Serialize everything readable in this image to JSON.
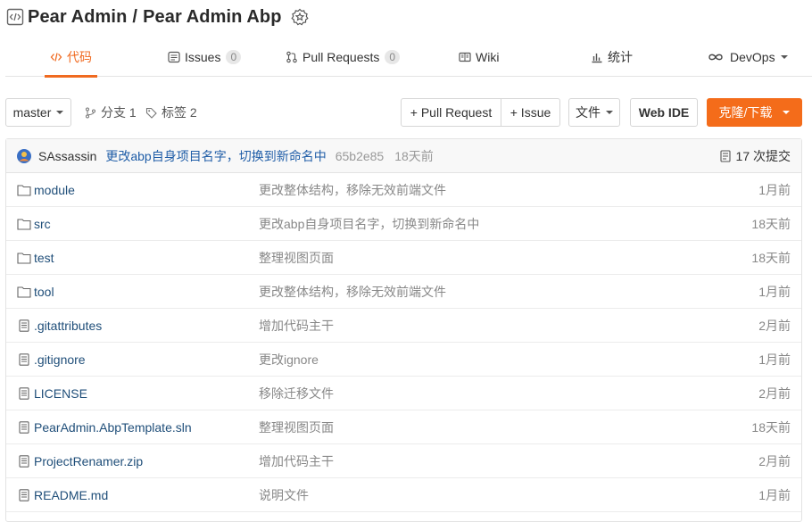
{
  "repo": {
    "owner": "Pear Admin",
    "separator": "/",
    "name": "Pear Admin Abp"
  },
  "tabs": [
    {
      "label": "代码",
      "icon": "code-icon",
      "active": true
    },
    {
      "label": "Issues",
      "count": "0",
      "icon": "issues-icon"
    },
    {
      "label": "Pull Requests",
      "count": "0",
      "icon": "pull-request-icon"
    },
    {
      "label": "Wiki",
      "icon": "wiki-icon"
    },
    {
      "label": "统计",
      "icon": "stats-icon"
    },
    {
      "label": "DevOps",
      "icon": "infinity-icon",
      "dropdown": true
    }
  ],
  "toolbar": {
    "branch": "master",
    "branches_label": "分支 1",
    "tags_label": "标签 2",
    "pull_request_btn": "+ Pull Request",
    "issue_btn": "+ Issue",
    "file_btn": "文件",
    "webide_btn": "Web IDE",
    "clone_btn": "克隆/下载"
  },
  "latest_commit": {
    "author": "SAssassin",
    "message": "更改abp自身项目名字，切换到新命名中",
    "hash": "65b2e85",
    "time": "18天前",
    "commit_count": "17 次提交"
  },
  "files": [
    {
      "type": "folder",
      "name": "module",
      "commit": "更改整体结构，移除无效前端文件",
      "time": "1月前"
    },
    {
      "type": "folder",
      "name": "src",
      "commit": "更改abp自身项目名字，切换到新命名中",
      "time": "18天前"
    },
    {
      "type": "folder",
      "name": "test",
      "commit": "整理视图页面",
      "time": "18天前"
    },
    {
      "type": "folder",
      "name": "tool",
      "commit": "更改整体结构，移除无效前端文件",
      "time": "1月前"
    },
    {
      "type": "file",
      "name": ".gitattributes",
      "commit": "增加代码主干",
      "time": "2月前"
    },
    {
      "type": "file",
      "name": ".gitignore",
      "commit": "更改ignore",
      "time": "1月前"
    },
    {
      "type": "file",
      "name": "LICENSE",
      "commit": "移除迁移文件",
      "time": "2月前"
    },
    {
      "type": "file",
      "name": "PearAdmin.AbpTemplate.sln",
      "commit": "整理视图页面",
      "time": "18天前"
    },
    {
      "type": "file",
      "name": "ProjectRenamer.zip",
      "commit": "增加代码主干",
      "time": "2月前"
    },
    {
      "type": "file",
      "name": "README.md",
      "commit": "说明文件",
      "time": "1月前"
    }
  ],
  "colors": {
    "accent": "#f06a20",
    "link": "#1f4e79"
  }
}
